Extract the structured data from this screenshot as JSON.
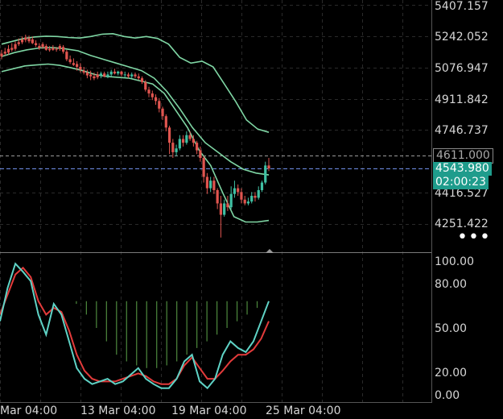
{
  "chart_data": [
    {
      "type": "candlestick",
      "price_axis_ticks": [
        "5407.157",
        "5242.052",
        "5076.947",
        "4911.842",
        "4746.737",
        "4416.527",
        "4251.422"
      ],
      "ylim": [
        4251.422,
        5407.157
      ],
      "current_price_tag": "4543.980",
      "countdown_tag": "02:00:23",
      "reference_price_tag": "4611.000",
      "colors": {
        "up": "#3fc0a3",
        "down": "#e0554f",
        "band": "#7fd6a4",
        "price_line": "#6f8fe8",
        "tag_bg": "#1f9c8c"
      },
      "candles": [
        [
          5150,
          5135,
          5170,
          5120
        ],
        [
          5160,
          5150,
          5180,
          5140
        ],
        [
          5175,
          5155,
          5195,
          5145
        ],
        [
          5180,
          5170,
          5205,
          5160
        ],
        [
          5200,
          5175,
          5215,
          5165
        ],
        [
          5210,
          5200,
          5230,
          5190
        ],
        [
          5225,
          5210,
          5240,
          5200
        ],
        [
          5235,
          5222,
          5250,
          5210
        ],
        [
          5230,
          5215,
          5245,
          5205
        ],
        [
          5225,
          5205,
          5240,
          5200
        ],
        [
          5205,
          5195,
          5220,
          5185
        ],
        [
          5190,
          5180,
          5205,
          5170
        ],
        [
          5200,
          5185,
          5210,
          5175
        ],
        [
          5190,
          5170,
          5200,
          5165
        ],
        [
          5175,
          5168,
          5190,
          5160
        ],
        [
          5180,
          5170,
          5195,
          5165
        ],
        [
          5175,
          5172,
          5185,
          5160
        ],
        [
          5190,
          5175,
          5200,
          5165
        ],
        [
          5185,
          5160,
          5195,
          5150
        ],
        [
          5160,
          5120,
          5170,
          5110
        ],
        [
          5120,
          5105,
          5140,
          5095
        ],
        [
          5100,
          5090,
          5125,
          5085
        ],
        [
          5095,
          5080,
          5110,
          5060
        ],
        [
          5080,
          5065,
          5100,
          5050
        ],
        [
          5060,
          5050,
          5080,
          5040
        ],
        [
          5050,
          5035,
          5065,
          5020
        ],
        [
          5040,
          5030,
          5060,
          5010
        ],
        [
          5030,
          5020,
          5050,
          5010
        ],
        [
          5040,
          5025,
          5055,
          5015
        ],
        [
          5035,
          5045,
          5055,
          5020
        ],
        [
          5045,
          5030,
          5055,
          5025
        ],
        [
          5030,
          5040,
          5055,
          5020
        ],
        [
          5040,
          5055,
          5065,
          5030
        ],
        [
          5055,
          5045,
          5070,
          5040
        ],
        [
          5045,
          5055,
          5060,
          5035
        ],
        [
          5055,
          5040,
          5060,
          5030
        ],
        [
          5040,
          5040,
          5055,
          5025
        ],
        [
          5040,
          5030,
          5050,
          5020
        ],
        [
          5030,
          5040,
          5050,
          5020
        ],
        [
          5040,
          5030,
          5050,
          5020
        ],
        [
          5030,
          5020,
          5045,
          5010
        ],
        [
          5020,
          5000,
          5030,
          4990
        ],
        [
          5000,
          4960,
          5010,
          4950
        ],
        [
          4960,
          4940,
          4975,
          4920
        ],
        [
          4940,
          4920,
          4955,
          4905
        ],
        [
          4920,
          4900,
          4935,
          4880
        ],
        [
          4900,
          4860,
          4915,
          4840
        ],
        [
          4860,
          4820,
          4870,
          4800
        ],
        [
          4820,
          4760,
          4830,
          4740
        ],
        [
          4760,
          4680,
          4770,
          4620
        ],
        [
          4680,
          4630,
          4700,
          4600
        ],
        [
          4630,
          4650,
          4670,
          4610
        ],
        [
          4650,
          4700,
          4720,
          4640
        ],
        [
          4700,
          4680,
          4720,
          4660
        ],
        [
          4680,
          4720,
          4740,
          4670
        ],
        [
          4720,
          4700,
          4740,
          4690
        ],
        [
          4700,
          4680,
          4720,
          4660
        ],
        [
          4680,
          4640,
          4690,
          4620
        ],
        [
          4640,
          4600,
          4660,
          4580
        ],
        [
          4600,
          4500,
          4610,
          4470
        ],
        [
          4500,
          4440,
          4520,
          4410
        ],
        [
          4440,
          4480,
          4500,
          4420
        ],
        [
          4480,
          4430,
          4500,
          4410
        ],
        [
          4430,
          4360,
          4440,
          4330
        ],
        [
          4360,
          4300,
          4400,
          4180
        ],
        [
          4300,
          4360,
          4380,
          4290
        ],
        [
          4360,
          4340,
          4400,
          4320
        ],
        [
          4340,
          4410,
          4450,
          4330
        ],
        [
          4410,
          4440,
          4480,
          4390
        ],
        [
          4440,
          4420,
          4460,
          4400
        ],
        [
          4420,
          4380,
          4440,
          4360
        ],
        [
          4380,
          4360,
          4400,
          4350
        ],
        [
          4360,
          4370,
          4390,
          4350
        ],
        [
          4370,
          4400,
          4420,
          4360
        ],
        [
          4400,
          4390,
          4420,
          4370
        ],
        [
          4390,
          4430,
          4450,
          4380
        ],
        [
          4430,
          4470,
          4480,
          4420
        ],
        [
          4470,
          4560,
          4580,
          4460
        ],
        [
          4560,
          4543.98,
          4600,
          4530
        ]
      ],
      "band_upper": [
        5200,
        5215,
        5230,
        5238,
        5242,
        5240,
        5235,
        5232,
        5240,
        5252,
        5255,
        5240,
        5232,
        5240,
        5230,
        5200,
        5130,
        5100,
        5110,
        5080,
        4990,
        4900,
        4800,
        4752,
        4735
      ],
      "band_middle": [
        5135,
        5155,
        5170,
        5180,
        5182,
        5175,
        5165,
        5140,
        5120,
        5100,
        5080,
        5060,
        5020,
        4950,
        4860,
        4760,
        4680,
        4630,
        4580,
        4540,
        4520,
        4510
      ],
      "band_lower": [
        5055,
        5070,
        5085,
        5090,
        5095,
        5088,
        5075,
        5060,
        5040,
        5030,
        5025,
        5020,
        5005,
        4990,
        4940,
        4850,
        4760,
        4640,
        4560,
        4420,
        4290,
        4262,
        4262,
        4270
      ],
      "x_tick_labels": [
        "Mar 04:00",
        "13 Mar 04:00",
        "19 Mar 04:00",
        "25 Mar 04:00"
      ]
    },
    {
      "type": "line",
      "ylim": [
        0,
        100
      ],
      "y_ticks": [
        "100.00",
        "80.00",
        "50.00",
        "20.00",
        "0.00"
      ],
      "colors": {
        "k_line": "#5fd3c6",
        "d_line": "#e33b3b",
        "histogram": "#4e8a3e"
      },
      "k_values": [
        55,
        80,
        98,
        92,
        85,
        60,
        45,
        68,
        60,
        40,
        20,
        12,
        8,
        10,
        12,
        8,
        10,
        15,
        20,
        12,
        8,
        5,
        5,
        12,
        25,
        30,
        10,
        5,
        12,
        30,
        40,
        35,
        32,
        40,
        55,
        70
      ],
      "d_values": [
        60,
        75,
        90,
        95,
        88,
        70,
        60,
        65,
        62,
        48,
        30,
        18,
        12,
        10,
        10,
        10,
        12,
        14,
        16,
        14,
        10,
        8,
        8,
        12,
        22,
        28,
        20,
        12,
        12,
        18,
        25,
        30,
        30,
        34,
        42,
        55
      ],
      "histogram_levels": [
        70,
        70,
        70,
        70,
        70,
        70,
        68,
        60,
        50,
        40,
        30,
        25,
        22,
        20,
        20,
        22,
        25,
        30,
        35,
        40,
        45,
        50,
        55,
        60,
        65,
        70
      ]
    }
  ]
}
